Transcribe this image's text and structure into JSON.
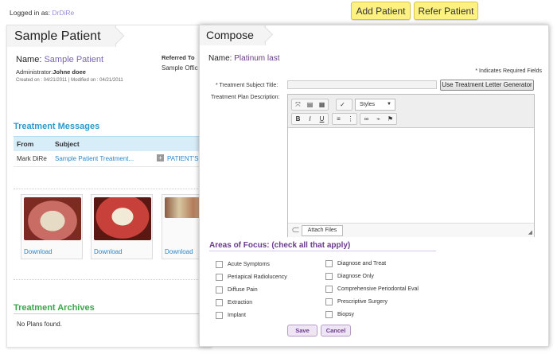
{
  "topbar": {
    "logged_in_label": "Logged in as:",
    "user": "DrDiRe",
    "add_patient": "Add Patient",
    "refer_patient": "Refer Patient"
  },
  "patient": {
    "tab_title": "Sample Patient",
    "name_label": "Name:",
    "name_value": "Sample Patient",
    "admin_label": "Administrator:",
    "admin_value": "Johne doee",
    "created": "Created on : 04/21/2011  |  Modified on : 04/21/2011",
    "referred_label": "Referred To",
    "referred_value": "Sample Offic"
  },
  "messages": {
    "title": "Treatment Messages",
    "columns": [
      "From",
      "Subject"
    ],
    "row": {
      "from": "Mark DiRe",
      "subject": "Sample Patient Treatment...",
      "action": "PATIENT'S CI"
    }
  },
  "gallery": {
    "download_label": "Download"
  },
  "archives": {
    "title": "Treatment Archives",
    "empty": "No Plans found."
  },
  "compose": {
    "tab_title": "Compose",
    "name_label": "Name:",
    "name_value": "Platinum last",
    "required_note": "* Indicates Required Fields",
    "subject_label": "* Treatment Subject Title:",
    "subject_value": "",
    "generator_button": "Use Treatment Letter Generator",
    "desc_label": "Treatment Plan Description:",
    "styles_select": "Styles",
    "attach_button": "Attach Files",
    "areas_title": "Areas of Focus: (check all that apply)",
    "areas_col1": [
      "Acute Symptoms",
      "Periapical Radiolucency",
      "Diffuse Pain",
      "Extraction",
      "Implant"
    ],
    "areas_col2": [
      "Diagnose and Treat",
      "Diagnose Only",
      "Comprehensive Periodontal Eval",
      "Prescriptive Surgery",
      "Biopsy"
    ],
    "save": "Save",
    "cancel": "Cancel"
  },
  "colors": {
    "accent_purple": "#6b3a8c",
    "link_blue": "#2d86c8",
    "button_yellow": "#fdf281",
    "archives_green": "#3aa64a"
  }
}
